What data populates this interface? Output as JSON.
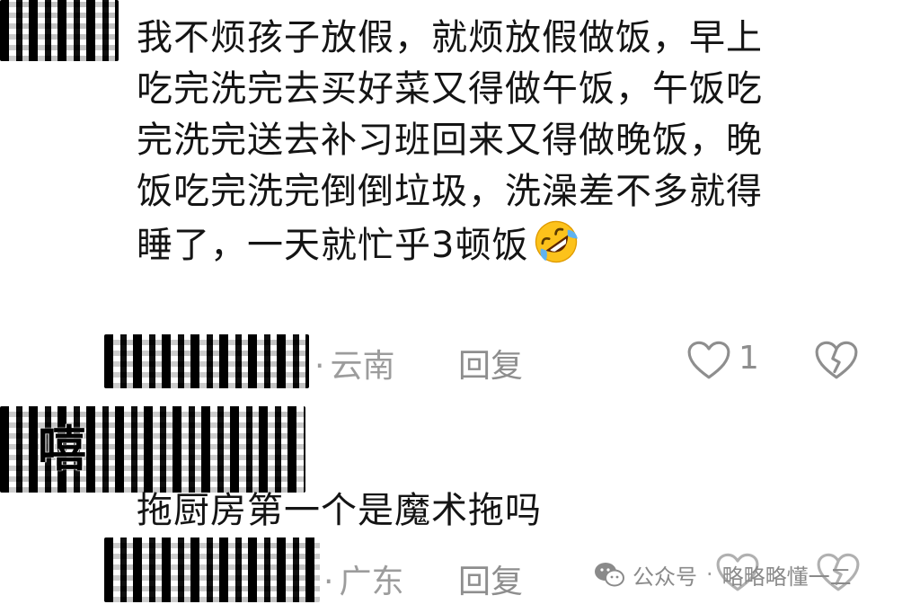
{
  "comment1": {
    "lines": [
      "我不烦孩子放假，就烦放假做饭，早上",
      "吃完洗完去买好菜又得做午饭，午饭吃",
      "完洗完送去补习班回来又得做晚饭，晚",
      "饭吃完洗完倒倒垃圾，洗澡差不多就得",
      "睡了，一天就忙乎3顿饭"
    ],
    "emoji": "rolling-on-floor-laughing-emoji",
    "location": "云南",
    "separator": "·",
    "reply_label": "回复",
    "like_count": "1"
  },
  "comment2": {
    "text": "拖厨房第一个是魔术拖吗",
    "location": "广东",
    "separator": "·",
    "reply_label": "回复"
  },
  "censored_name_glyph": "嘻",
  "watermark": {
    "prefix": "公众号",
    "separator": "·",
    "account": "略略略懂一二"
  },
  "colors": {
    "text": "#141414",
    "meta": "#9c9c9c",
    "icon": "#8e8e8e",
    "background": "#ffffff"
  }
}
